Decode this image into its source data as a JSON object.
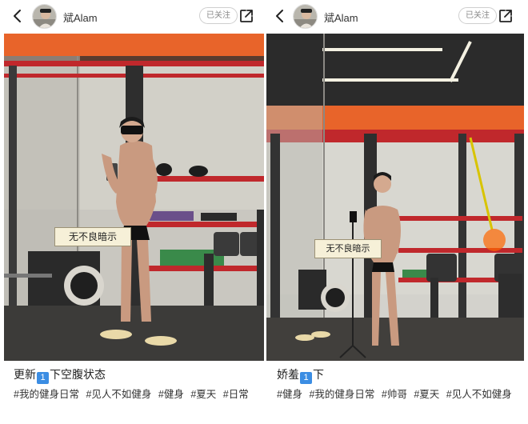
{
  "posts": [
    {
      "username": "斌Alam",
      "follow_label": "已关注",
      "photo_caption": "无不良暗示",
      "title_before": "更新",
      "title_badge": "1",
      "title_after": "下空腹状态",
      "tags": [
        "#我的健身日常",
        "#见人不如健身",
        "#健身",
        "#夏天",
        "#日常"
      ]
    },
    {
      "username": "斌Alam",
      "follow_label": "已关注",
      "photo_caption": "无不良暗示",
      "title_before": "娇羞",
      "title_badge": "1",
      "title_after": "下",
      "tags": [
        "#健身",
        "#我的健身日常",
        "#帅哥",
        "#夏天",
        "#见人不如健身"
      ]
    }
  ],
  "icons": {
    "back": "chevron-left-icon",
    "share": "share-icon",
    "badge": "keycap-one-icon"
  },
  "colors": {
    "accent_orange": "#e8642a",
    "rack_red": "#c0282c",
    "badge_blue": "#3b8de3"
  }
}
